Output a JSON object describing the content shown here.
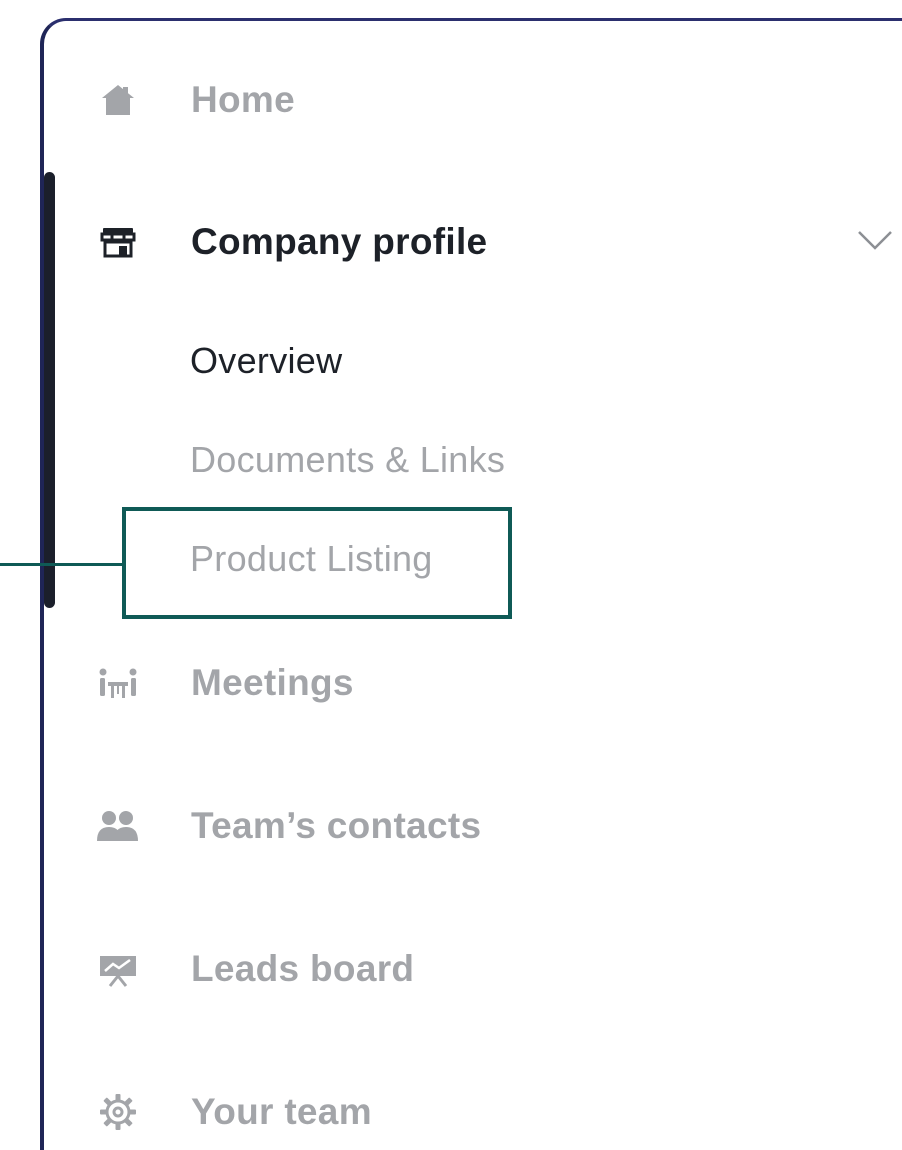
{
  "sidebar": {
    "items": [
      {
        "id": "home",
        "label": "Home",
        "icon": "home-icon"
      },
      {
        "id": "company-profile",
        "label": "Company profile",
        "icon": "storefront-icon",
        "expanded": true,
        "subitems": [
          {
            "id": "overview",
            "label": "Overview"
          },
          {
            "id": "documents-links",
            "label": "Documents & Links"
          },
          {
            "id": "product-listing",
            "label": "Product Listing"
          }
        ]
      },
      {
        "id": "meetings",
        "label": "Meetings",
        "icon": "meeting-table-icon"
      },
      {
        "id": "teams-contacts",
        "label": "Team’s contacts",
        "icon": "contacts-icon"
      },
      {
        "id": "leads-board",
        "label": "Leads board",
        "icon": "presentation-board-icon"
      },
      {
        "id": "your-team",
        "label": "Your team",
        "icon": "gear-icon"
      }
    ]
  },
  "colors": {
    "inactive_text": "#a3a5a9",
    "active_text": "#1d2128",
    "highlight": "#0f5a56",
    "frame": "#1f2557"
  }
}
